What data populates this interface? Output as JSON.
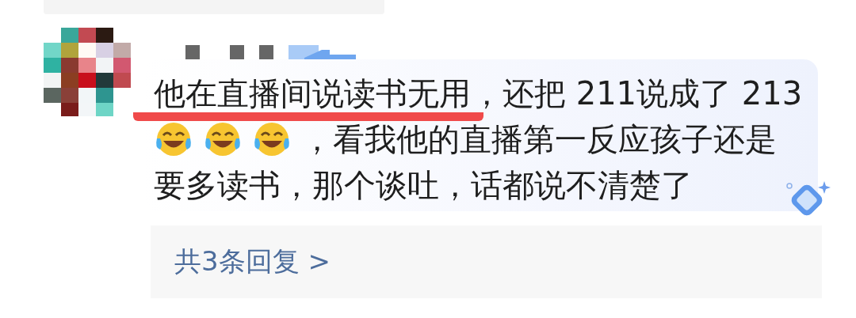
{
  "comment": {
    "lines": [
      {
        "parts": [
          {
            "kind": "text",
            "text": "他在直播间说读书无用",
            "underline": true
          },
          {
            "kind": "text",
            "text": "，还把 211说成了 213",
            "underline": false
          }
        ]
      },
      {
        "parts": [
          {
            "kind": "emoji"
          },
          {
            "kind": "emoji"
          },
          {
            "kind": "emoji"
          },
          {
            "kind": "text",
            "text": "，看我他的直播第一反应孩子还是",
            "underline": false
          }
        ]
      },
      {
        "parts": [
          {
            "kind": "text",
            "text": "要多读书，那个谈吐，话都说不清楚了",
            "underline": false
          }
        ]
      }
    ]
  },
  "replies": {
    "label": "共3条回复 >"
  }
}
